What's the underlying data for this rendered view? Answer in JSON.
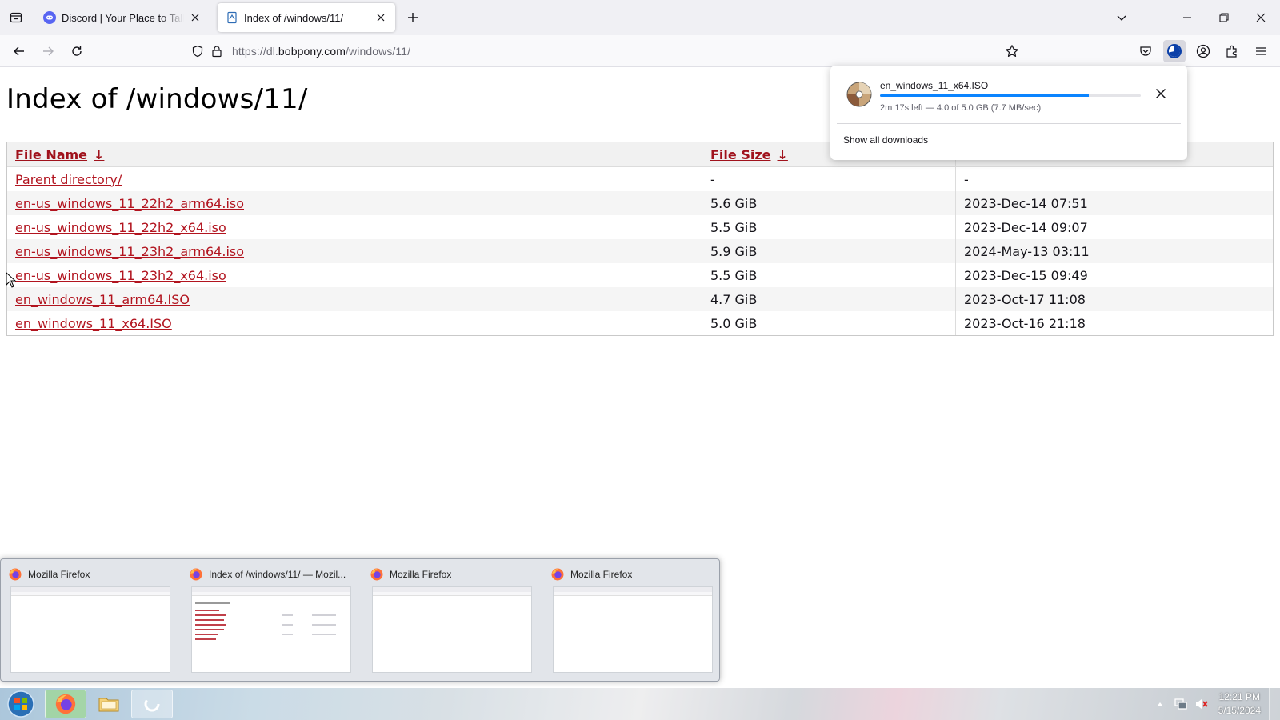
{
  "browser": {
    "tabs": [
      {
        "title": "Discord | Your Place to Talk and Hang Out",
        "active": false,
        "icon": "discord-icon"
      },
      {
        "title": "Index of /windows/11/",
        "active": true,
        "icon": "page-icon"
      }
    ],
    "url": {
      "prefix": "https://dl.",
      "domain": "bobpony.com",
      "path": "/windows/11/"
    }
  },
  "page": {
    "title": "Index of /windows/11/",
    "columns": {
      "name": "File Name",
      "size": "File Size",
      "sort_arrow": "↓"
    },
    "rows": [
      {
        "name": "Parent directory/",
        "size": "-",
        "date": "-"
      },
      {
        "name": "en-us_windows_11_22h2_arm64.iso",
        "size": "5.6 GiB",
        "date": "2023-Dec-14 07:51"
      },
      {
        "name": "en-us_windows_11_22h2_x64.iso",
        "size": "5.5 GiB",
        "date": "2023-Dec-14 09:07"
      },
      {
        "name": "en-us_windows_11_23h2_arm64.iso",
        "size": "5.9 GiB",
        "date": "2024-May-13 03:11"
      },
      {
        "name": "en-us_windows_11_23h2_x64.iso",
        "size": "5.5 GiB",
        "date": "2023-Dec-15 09:49"
      },
      {
        "name": "en_windows_11_arm64.ISO",
        "size": "4.7 GiB",
        "date": "2023-Oct-17 11:08"
      },
      {
        "name": "en_windows_11_x64.ISO",
        "size": "5.0 GiB",
        "date": "2023-Oct-16 21:18"
      }
    ]
  },
  "downloads_panel": {
    "filename": "en_windows_11_x64.ISO",
    "progress_fraction": 0.8,
    "status": "2m 17s left — 4.0 of 5.0 GB (7.7 MB/sec)",
    "show_all": "Show all downloads"
  },
  "taskbar_preview": {
    "windows": [
      {
        "title": "Mozilla Firefox"
      },
      {
        "title": "Index of /windows/11/ — Mozil..."
      },
      {
        "title": "Mozilla Firefox"
      },
      {
        "title": "Mozilla Firefox"
      }
    ]
  },
  "taskbar": {
    "time": "12:21 PM",
    "date": "5/15/2024"
  },
  "colors": {
    "link": "#b2141f",
    "accent": "#0a84ff",
    "tabstrip": "#f0f0f4"
  }
}
